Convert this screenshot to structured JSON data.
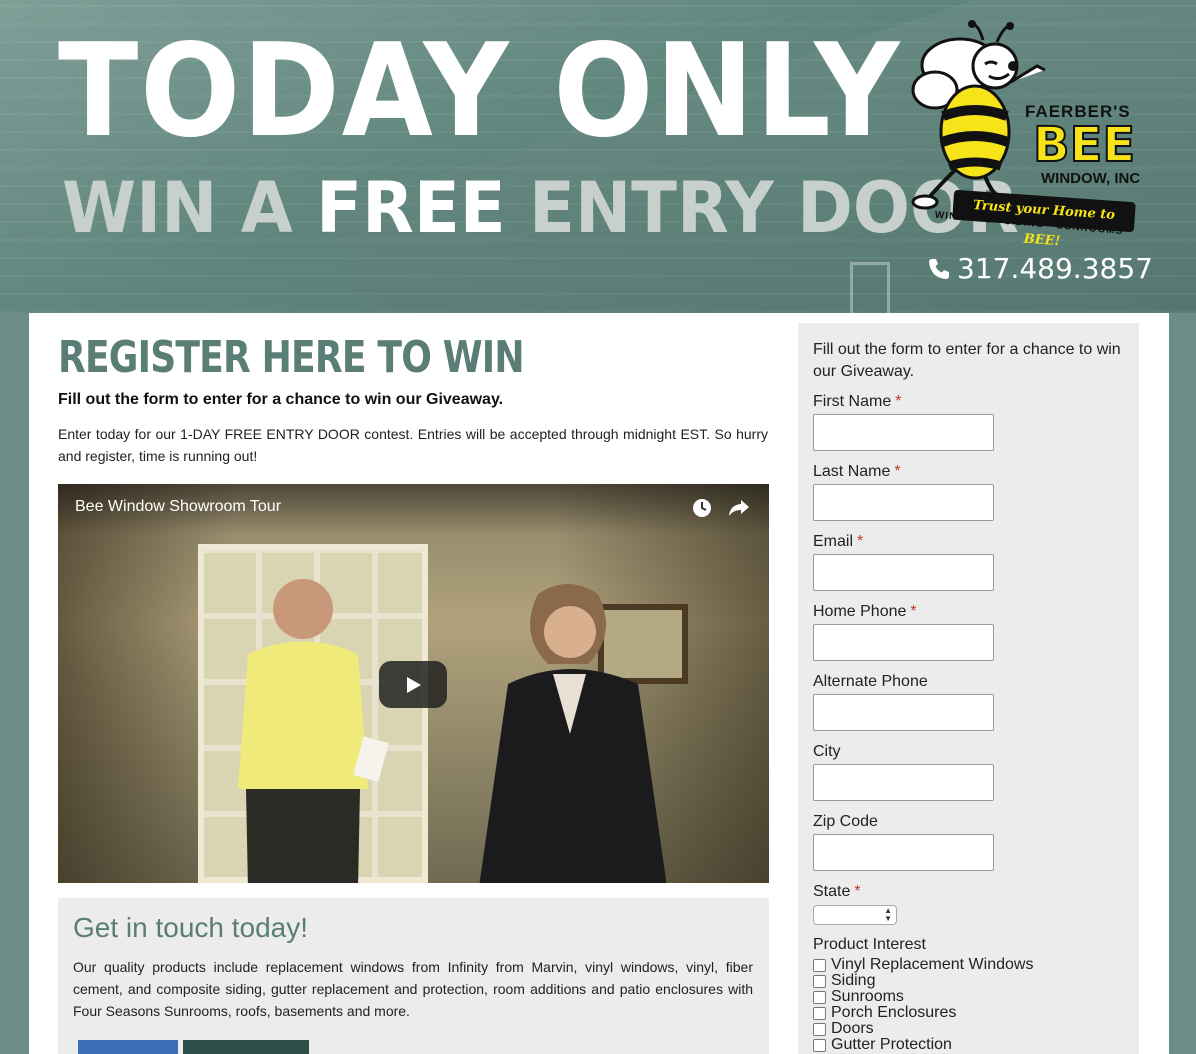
{
  "hero": {
    "headline": "TODAY ONLY",
    "subhead_pre": "WIN A",
    "subhead_strong": "FREE",
    "subhead_post": "ENTRY DOOR",
    "logo": {
      "name_top": "FAERBER'S",
      "name_main": "BEE",
      "name_sub": "WINDOW, INC",
      "slogan": "Trust your Home to BEE!",
      "services": "WINDOWS • SIDING • SUNROOMS"
    },
    "phone": "317.489.3857"
  },
  "main": {
    "title": "REGISTER HERE TO WIN",
    "subtitle": "Fill out the form to enter for a chance to win our Giveaway.",
    "body": "Enter today for our 1-DAY FREE ENTRY DOOR contest. Entries will be accepted through midnight EST. So hurry and register, time is running out!",
    "video": {
      "title": "Bee Window Showroom Tour"
    },
    "touch": {
      "title": "Get in touch today!",
      "body": "Our quality products include replacement windows from Infinity from Marvin, vinyl windows, vinyl, fiber cement, and composite siding, gutter replacement and protection, room additions and patio enclosures with Four Seasons Sunrooms, roofs, basements and more."
    }
  },
  "form": {
    "intro": "Fill out the form to enter for a chance to win our Giveaway.",
    "required_mark": "*",
    "fields": [
      {
        "label": "First Name",
        "required": true,
        "value": ""
      },
      {
        "label": "Last Name",
        "required": true,
        "value": ""
      },
      {
        "label": "Email",
        "required": true,
        "value": ""
      },
      {
        "label": "Home Phone",
        "required": true,
        "value": ""
      },
      {
        "label": "Alternate Phone",
        "required": false,
        "value": ""
      },
      {
        "label": "City",
        "required": false,
        "value": ""
      },
      {
        "label": "Zip Code",
        "required": false,
        "value": ""
      }
    ],
    "state": {
      "label": "State",
      "value": ""
    },
    "product_interest": {
      "label": "Product Interest",
      "options": [
        "Vinyl Replacement Windows",
        "Siding",
        "Sunrooms",
        "Porch Enclosures",
        "Doors",
        "Gutter Protection"
      ]
    }
  },
  "colors": {
    "brand_green": "#5a7e76",
    "logo_yellow": "#f7e31a",
    "required_red": "#c0392b"
  }
}
